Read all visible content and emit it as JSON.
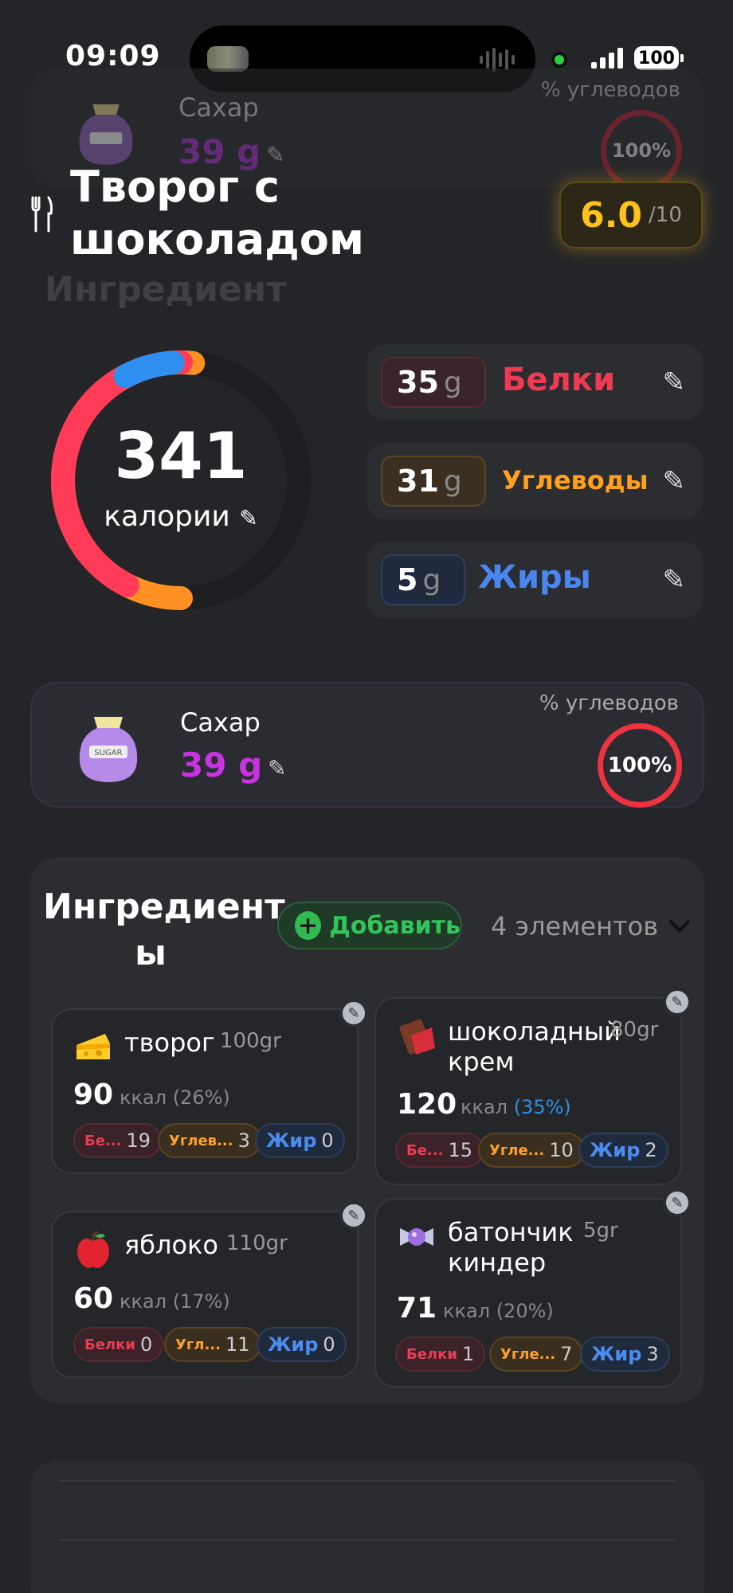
{
  "status": {
    "time": "09:09",
    "battery": "100"
  },
  "ghost_card": {
    "name": "Сахар",
    "grams": "39 g",
    "label": "% углеводов",
    "percent": "100%",
    "heading": "Ингредиент"
  },
  "header": {
    "title_line1": "Творог с",
    "title_line2": "шоколадом",
    "score": "6.0",
    "score_max": "/10"
  },
  "calories": {
    "value": "341",
    "label": "калории",
    "segments": {
      "protein_frac": 0.41,
      "carbs_frac": 0.36,
      "fat_frac": 0.06
    }
  },
  "macros": [
    {
      "value": "35",
      "unit": "g",
      "name": "Белки",
      "color": "#ef3a52"
    },
    {
      "value": "31",
      "unit": "g",
      "name": "Углеводы",
      "color": "#ffa11f"
    },
    {
      "value": "5",
      "unit": "g",
      "name": "Жиры",
      "color": "#4a86f0"
    }
  ],
  "sugar": {
    "name": "Сахар",
    "grams": "39 g",
    "label": "% углеводов",
    "percent": "100%"
  },
  "ingredients": {
    "title_line1": "Ингредиент",
    "title_line2": "ы",
    "add_label": "Добавить",
    "count": "4 элементов",
    "items": [
      {
        "emoji": "cheese-icon",
        "name1": "творог",
        "name2": "",
        "weight": "100gr",
        "kcal": "90",
        "kcal_unit": "ккал",
        "pct": "(26%)",
        "protein_label": "Бе...",
        "protein": "19",
        "carbs_label": "Углев...",
        "carbs": "3",
        "fat_label": "Жир",
        "fat": "0"
      },
      {
        "emoji": "chocolate-icon",
        "name1": "шоколадный",
        "name2": "крем",
        "weight": "80gr",
        "kcal": "120",
        "kcal_unit": "ккал",
        "pct": "(35%)",
        "protein_label": "Бе...",
        "protein": "15",
        "carbs_label": "Угле...",
        "carbs": "10",
        "fat_label": "Жир",
        "fat": "2"
      },
      {
        "emoji": "apple-icon",
        "name1": "яблоко",
        "name2": "",
        "weight": "110gr",
        "kcal": "60",
        "kcal_unit": "ккал",
        "pct": "(17%)",
        "protein_label": "Белки",
        "protein": "0",
        "carbs_label": "Угл...",
        "carbs": "11",
        "fat_label": "Жир",
        "fat": "0"
      },
      {
        "emoji": "candy-icon",
        "name1": "батончик",
        "name2": "киндер",
        "weight": "5gr",
        "kcal": "71",
        "kcal_unit": "ккал",
        "pct": "(20%)",
        "protein_label": "Белки",
        "protein": "1",
        "carbs_label": "Угле...",
        "carbs": "7",
        "fat_label": "Жир",
        "fat": "3"
      }
    ]
  },
  "colors": {
    "accent_score": "#ffc21a",
    "sugar": "#c834e0",
    "add_green": "#33c45a",
    "pct_highlight": "#2f8fe0"
  }
}
